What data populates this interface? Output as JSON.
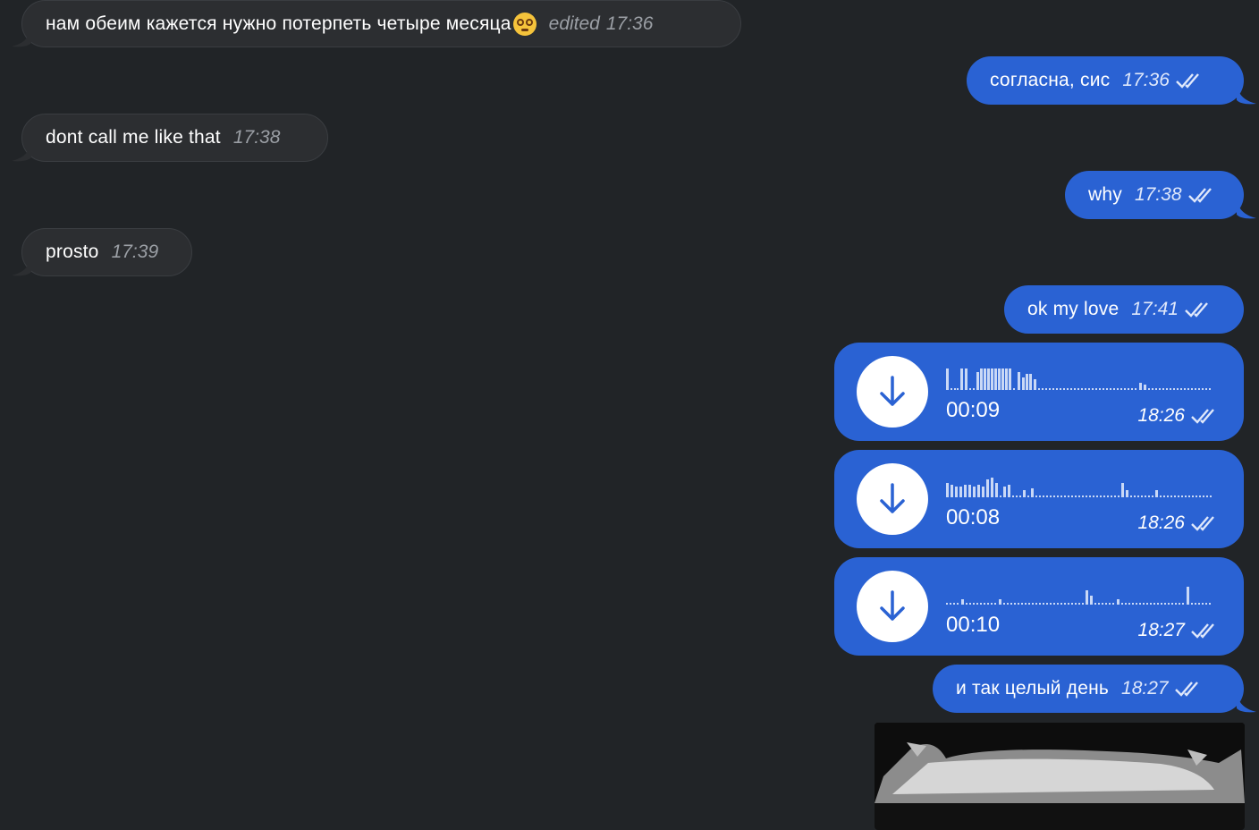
{
  "messages": [
    {
      "text": "нам обеим кажется нужно потерпеть четыре месяца",
      "emoji": "dizzy-face-emoji",
      "edited_label": "edited",
      "time": "17:36"
    },
    {
      "text": "согласна, сис",
      "time": "17:36"
    },
    {
      "text": "dont call me like that",
      "time": "17:38"
    },
    {
      "text": "why",
      "time": "17:38"
    },
    {
      "text": "prosto",
      "time": "17:39"
    },
    {
      "text": "ok my love",
      "time": "17:41"
    },
    {
      "text": "и так целый день",
      "time": "18:27"
    }
  ],
  "voice_messages": [
    {
      "duration": "00:09",
      "time": "18:26"
    },
    {
      "duration": "00:08",
      "time": "18:26"
    },
    {
      "duration": "00:10",
      "time": "18:27"
    }
  ],
  "colors": {
    "background": "#212427",
    "incoming_bubble": "#2c2e31",
    "outgoing_bubble": "#2a62d3",
    "incoming_time": "#9b9fa5",
    "outgoing_time": "#dfe8fb"
  },
  "icons": {
    "read_status": "double-check-icon",
    "voice_download": "download-arrow-icon"
  }
}
